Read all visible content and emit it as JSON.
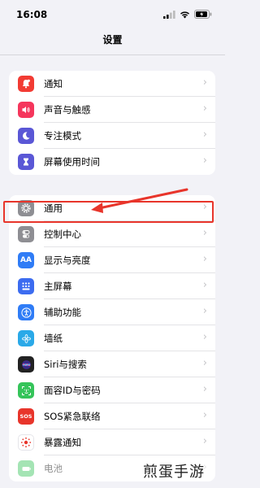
{
  "status_bar": {
    "time": "16:08"
  },
  "header": {
    "title": "设置"
  },
  "groups": [
    {
      "items": [
        {
          "label": "通知",
          "icon": "bell-icon",
          "color": "#f23b33"
        },
        {
          "label": "声音与触感",
          "icon": "speaker-icon",
          "color": "#f5365c"
        },
        {
          "label": "专注模式",
          "icon": "moon-icon",
          "color": "#5a57d6"
        },
        {
          "label": "屏幕使用时间",
          "icon": "hourglass-icon",
          "color": "#5a57d6"
        }
      ]
    },
    {
      "items": [
        {
          "label": "通用",
          "icon": "gear-icon",
          "color": "#8e8e93"
        },
        {
          "label": "控制中心",
          "icon": "toggle-icon",
          "color": "#8e8e93"
        },
        {
          "label": "显示与亮度",
          "icon": "aa-icon",
          "glyph": "AA",
          "color": "#2f7cf6"
        },
        {
          "label": "主屏幕",
          "icon": "home-grid-icon",
          "color": "#3c6cf0"
        },
        {
          "label": "辅助功能",
          "icon": "accessibility-icon",
          "color": "#2f7cf6"
        },
        {
          "label": "墙纸",
          "icon": "flower-icon",
          "color": "#2aa9e8"
        },
        {
          "label": "Siri与搜索",
          "icon": "siri-icon",
          "color": "#222222"
        },
        {
          "label": "面容ID与密码",
          "icon": "faceid-icon",
          "color": "#35c45a"
        },
        {
          "label": "SOS紧急联络",
          "icon": "sos-icon",
          "glyph": "SOS",
          "color": "#e8352b"
        },
        {
          "label": "暴露通知",
          "icon": "exposure-icon",
          "color": "#ffffff"
        },
        {
          "label": "电池",
          "icon": "battery-icon",
          "color": "#35c45a"
        }
      ]
    }
  ],
  "watermark": "煎蛋手游"
}
